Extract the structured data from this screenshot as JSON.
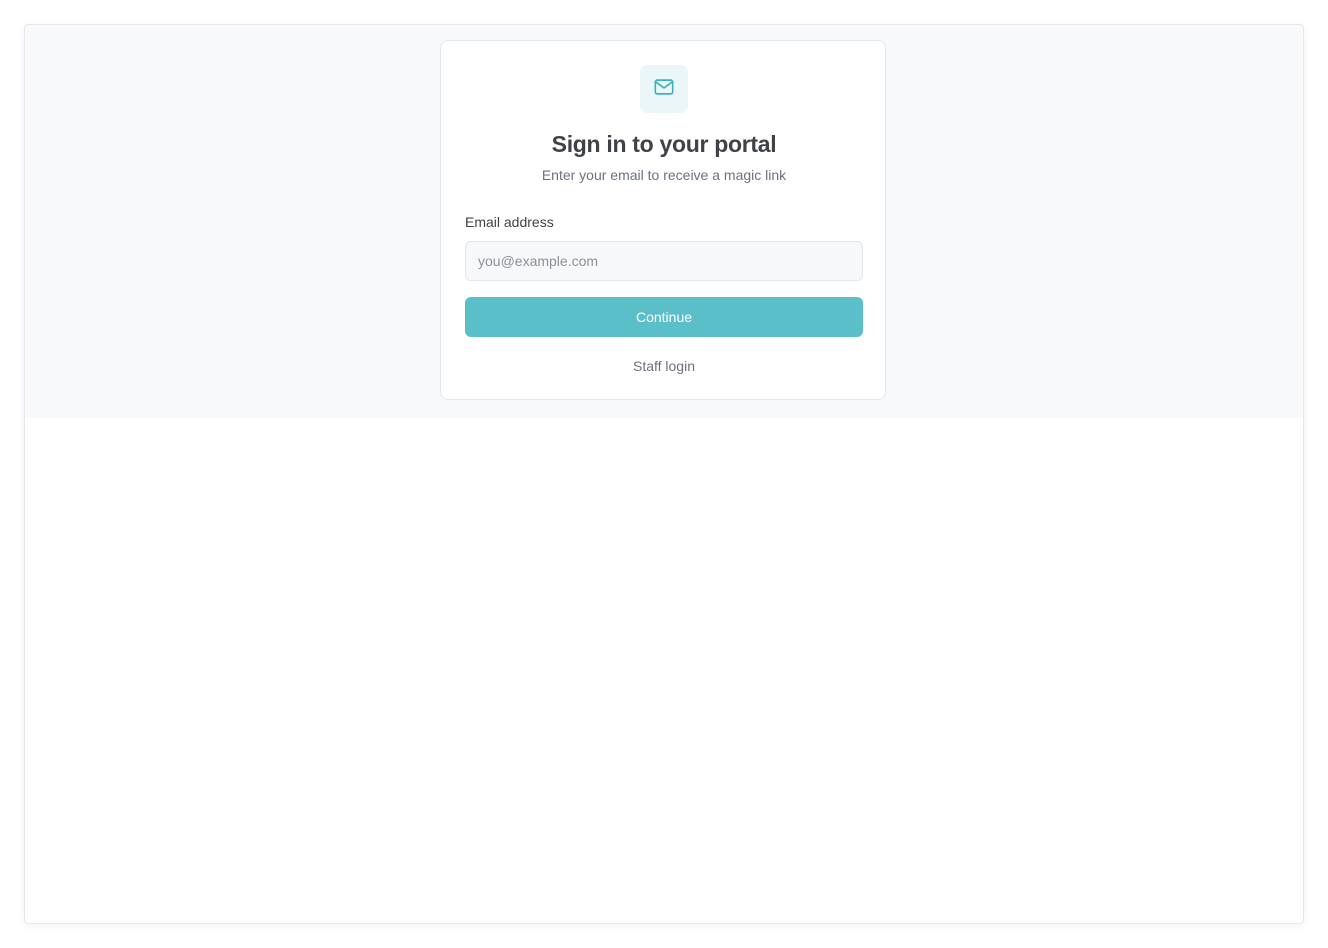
{
  "login": {
    "title": "Sign in to your portal",
    "subtitle": "Enter your email to receive a magic link",
    "email_label": "Email address",
    "email_placeholder": "you@example.com",
    "email_value": "",
    "continue_label": "Continue",
    "staff_login_label": "Staff login"
  },
  "icons": {
    "header_icon": "mail-icon"
  },
  "colors": {
    "accent": "#5bbfc9",
    "icon_background": "#ebf6f8",
    "band_background": "#f8f9fb"
  }
}
